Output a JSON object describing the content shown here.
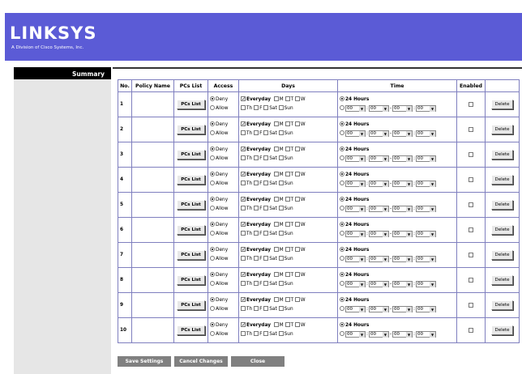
{
  "brand": {
    "name": "LINKSYS",
    "tagline": "A Division of Cisco Systems, Inc."
  },
  "sidebar": {
    "summary_label": "Summary"
  },
  "table": {
    "headers": [
      "No.",
      "Policy Name",
      "PCs List",
      "Access",
      "Days",
      "Time",
      "Enabled",
      ""
    ],
    "rows": [
      {
        "no": "1",
        "policy_name": ""
      },
      {
        "no": "2",
        "policy_name": ""
      },
      {
        "no": "3",
        "policy_name": ""
      },
      {
        "no": "4",
        "policy_name": ""
      },
      {
        "no": "5",
        "policy_name": ""
      },
      {
        "no": "6",
        "policy_name": ""
      },
      {
        "no": "7",
        "policy_name": ""
      },
      {
        "no": "8",
        "policy_name": ""
      },
      {
        "no": "9",
        "policy_name": ""
      },
      {
        "no": "10",
        "policy_name": ""
      }
    ],
    "pcs_list_label": "PCs List",
    "access": {
      "deny": "Deny",
      "allow": "Allow",
      "selected": "Deny"
    },
    "days": {
      "everyday": "Everyday",
      "everyday_checked": true,
      "line1": [
        "M",
        "T",
        "W"
      ],
      "line2": [
        "Th",
        "F",
        "Sat",
        "Sun"
      ]
    },
    "time": {
      "all_day": "24 Hours",
      "selected": "24 Hours",
      "start_hour": "00",
      "start_min": "00",
      "end_hour": "00",
      "end_min": "00"
    },
    "enabled": false,
    "delete_label": "Delete"
  },
  "footer": {
    "save": "Save Settings",
    "cancel": "Cancel Changes",
    "close": "Close"
  },
  "colors": {
    "header": "#5b5bd6",
    "border": "#7f7fbf",
    "footer_button": "#808080"
  }
}
